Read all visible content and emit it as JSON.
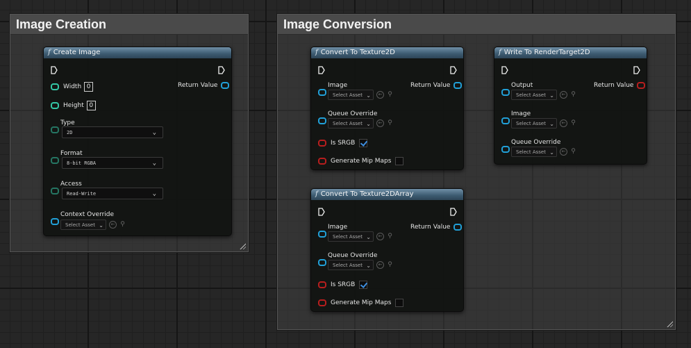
{
  "comments": {
    "image_creation": {
      "title": "Image Creation"
    },
    "image_conversion": {
      "title": "Image Conversion"
    }
  },
  "colors": {
    "header": "#3c5a70",
    "pin_object": "#21a0d8",
    "pin_int": "#34c7a6",
    "pin_bool": "#b81e1e"
  },
  "nodes": {
    "create_image": {
      "title": "Create Image",
      "width_label": "Width",
      "width_value": "0",
      "height_label": "Height",
      "height_value": "0",
      "type_label": "Type",
      "type_value": "2D",
      "format_label": "Format",
      "format_value": "8-bit RGBA",
      "access_label": "Access",
      "access_value": "Read-Write",
      "context_label": "Context Override",
      "context_value": "Select Asset",
      "return_label": "Return Value"
    },
    "convert_texture2d": {
      "title": "Convert To Texture2D",
      "image_label": "Image",
      "image_value": "Select Asset",
      "queue_label": "Queue Override",
      "queue_value": "Select Asset",
      "srgb_label": "Is SRGB",
      "srgb_checked": true,
      "mip_label": "Generate Mip Maps",
      "mip_checked": false,
      "return_label": "Return Value"
    },
    "convert_texture2d_array": {
      "title": "Convert To Texture2DArray",
      "image_label": "Image",
      "image_value": "Select Asset",
      "queue_label": "Queue Override",
      "queue_value": "Select Asset",
      "srgb_label": "Is SRGB",
      "srgb_checked": true,
      "mip_label": "Generate Mip Maps",
      "mip_checked": false,
      "return_label": "Return Value"
    },
    "write_rendertarget": {
      "title": "Write To RenderTarget2D",
      "output_label": "Output",
      "output_value": "Select Asset",
      "image_label": "Image",
      "image_value": "Select Asset",
      "queue_label": "Queue Override",
      "queue_value": "Select Asset",
      "return_label": "Return Value"
    }
  }
}
